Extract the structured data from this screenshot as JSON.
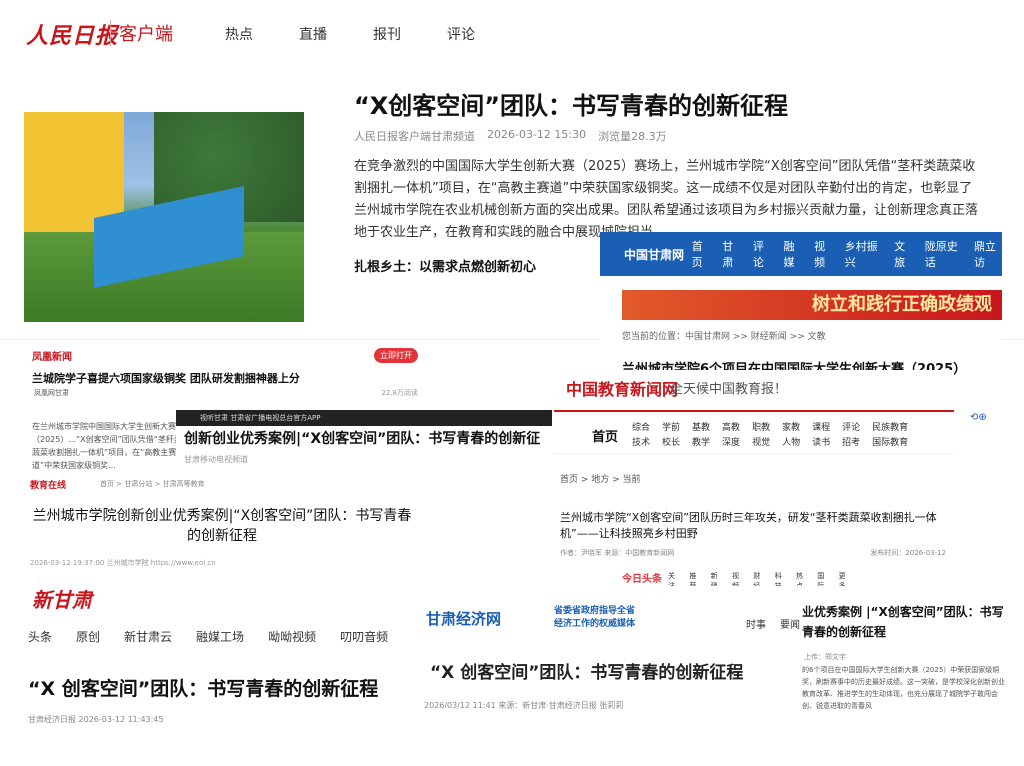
{
  "card1": {
    "logo": "人民日报",
    "logo_sub": "客户端",
    "nav": [
      "热点",
      "直播",
      "报刊",
      "评论"
    ],
    "title": "“X创客空间”团队：书写青春的创新征程",
    "meta_source": "人民日报客户端甘肃频道",
    "meta_time": "2026-03-12 15:30",
    "meta_views": "浏览量28.3万",
    "body": "在竞争激烈的中国国际大学生创新大赛（2025）赛场上，兰州城市学院“X创客空间”团队凭借“茎秆类蔬菜收割捆扎一体机”项目，在“高教主赛道”中荣获国家级铜奖。这一成绩不仅是对团队辛勤付出的肯定，也彰显了兰州城市学院在农业机械创新方面的突出成果。团队希望通过该项目为乡村振兴贡献力量，让创新理念真正落地于农业生产，在教育和实践的融合中展现城院担当。",
    "subheading": "扎根乡土：以需求点燃创新初心"
  },
  "card2": {
    "logo": "中国甘肃网",
    "nav": [
      "首页",
      "甘肃",
      "评论",
      "融媒",
      "视频",
      "乡村振兴",
      "文旅",
      "陇原史话",
      "鼎立访"
    ],
    "banner": "树立和践行正确政绩观",
    "crumb": "您当前的位置：中国甘肃网 >> 财经新闻 >> 文教",
    "title": "兰州城市学院6个项目在中国国际大学生创新大赛（2025）"
  },
  "card3": {
    "head": "凤凰新闻",
    "open_button": "立即打开",
    "title": "兰城院学子喜提六项国家级铜奖  团队研发割捆神器上分",
    "source": "凤凰网甘肃",
    "views": "22.8万阅读",
    "text": "在兰州城市学院中国国际大学生创新大赛（2025）...“X创客空间”团队凭借“茎秆类蔬菜收割捆扎一体机”项目，在“高教主赛道”中荣获国家级铜奖..."
  },
  "card4": {
    "topbar": "视听甘肃  甘肃省广播电视总台官方APP",
    "title": "创新创业优秀案例|“X创客空间”团队：书写青春的创新征",
    "source": "甘肃移动电视频道"
  },
  "card5": {
    "logo": "教育在线",
    "crumb": "首页 > 甘肃分站 > 甘肃高等教育",
    "title": "兰州城市学院创新创业优秀案例|“X创客空间”团队：书写青春的创新征程",
    "meta": "2026-03-12 19:37:00   兰州城市学院   https://www.eol.cn"
  },
  "card6": {
    "logo": "中国教育新闻网",
    "slogan": "全天候中国教育报！",
    "home": "首页",
    "nav": [
      "综合",
      "学前",
      "基教",
      "高教",
      "职教",
      "家教",
      "课程",
      "评论",
      "民族教育",
      "技术",
      "校长",
      "教学",
      "深度",
      "视觉",
      "人物",
      "读书",
      "招考",
      "国际教育"
    ],
    "crumb": "首页  >  地方  >  当前",
    "title": "兰州城市学院“X创客空间”团队历时三年攻关，研发“茎秆类蔬菜收割捆扎一体机”——让科技照亮乡村田野",
    "meta": "作者：尹晓军    来源：中国教育新闻网",
    "date": "发布时间：2026-03-12"
  },
  "card7": {
    "logo": "今日头条",
    "nav": [
      "关注",
      "推荐",
      "新疆",
      "视频",
      "财经",
      "科技",
      "热点",
      "国际",
      "更多"
    ]
  },
  "card8": {
    "logo": "新甘肃",
    "nav": [
      "头条",
      "原创",
      "新甘肃云",
      "融媒工场",
      "呦呦视频",
      "叨叨音频"
    ],
    "title": "“X 创客空间”团队：书写青春的创新征程",
    "meta": "甘肃经济日报   2026-03-12 11:43:45"
  },
  "card9": {
    "logo": "甘肃经济网",
    "logo_line1": "省委省政府指导全省",
    "logo_line2": "经济工作的权威媒体",
    "nav": [
      "时事",
      "要闻"
    ],
    "title": "“X 创客空间”团队：书写青春的创新征程",
    "meta": "2026/03/12 11:41   来源：新甘肃·甘肃经济日报   张莉莉"
  },
  "card10": {
    "title": "业优秀案例 |“X创客空间”团队：书写青春的创新征程",
    "meta": "上传：郑文宇",
    "text": "的6个项目在中国国际大学生创新大赛（2025）中荣获国家级铜奖，刷新赛事中的历史最好成绩。这一突破，是学校深化创新创业教育改革、推进学生的生动体现，也充分展现了城院学子敢闯会创、锐意进取的青春风"
  }
}
